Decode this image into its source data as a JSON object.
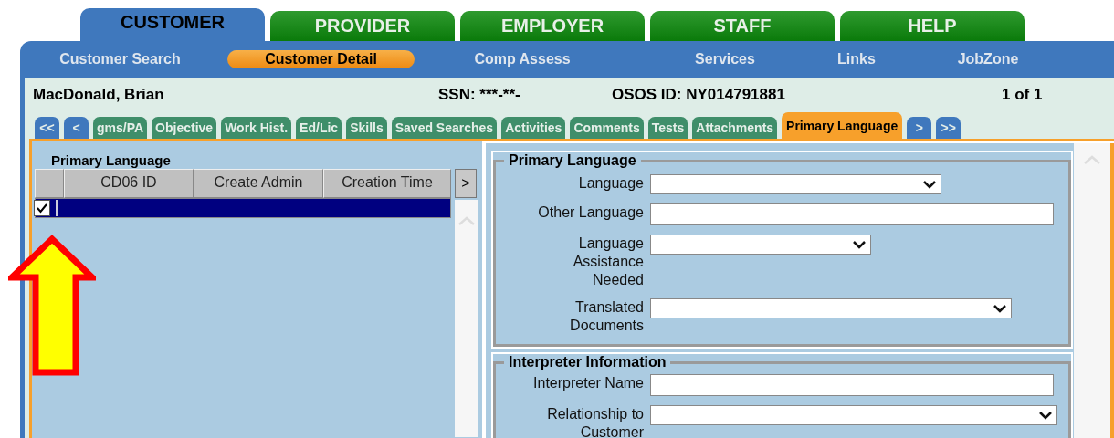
{
  "main_tabs": [
    {
      "label": "CUSTOMER",
      "selected": true
    },
    {
      "label": "PROVIDER",
      "selected": false
    },
    {
      "label": "EMPLOYER",
      "selected": false
    },
    {
      "label": "STAFF",
      "selected": false
    },
    {
      "label": "HELP",
      "selected": false
    }
  ],
  "sub_nav": [
    {
      "label": "Customer Search",
      "selected": false
    },
    {
      "label": "Customer Detail",
      "selected": true
    },
    {
      "label": "Comp Assess",
      "selected": false
    },
    {
      "label": "Services",
      "selected": false
    },
    {
      "label": "Links",
      "selected": false
    },
    {
      "label": "JobZone",
      "selected": false
    }
  ],
  "customer": {
    "name": "MacDonald, Brian",
    "ssn": "SSN: ***-**-",
    "osos_id": "OSOS ID: NY014791881",
    "record_count": "1 of 1"
  },
  "section_tabs": [
    {
      "label": "<<",
      "kind": "nav",
      "selected": false
    },
    {
      "label": "<",
      "kind": "nav",
      "selected": false
    },
    {
      "label": "gms/PA",
      "kind": "tab",
      "selected": false
    },
    {
      "label": "Objective",
      "kind": "tab",
      "selected": false
    },
    {
      "label": "Work Hist.",
      "kind": "tab",
      "selected": false
    },
    {
      "label": "Ed/Lic",
      "kind": "tab",
      "selected": false
    },
    {
      "label": "Skills",
      "kind": "tab",
      "selected": false
    },
    {
      "label": "Saved Searches",
      "kind": "tab",
      "selected": false
    },
    {
      "label": "Activities",
      "kind": "tab",
      "selected": false
    },
    {
      "label": "Comments",
      "kind": "tab",
      "selected": false
    },
    {
      "label": "Tests",
      "kind": "tab",
      "selected": false
    },
    {
      "label": "Attachments",
      "kind": "tab",
      "selected": false
    },
    {
      "label": "Primary Language",
      "kind": "tab",
      "selected": true
    },
    {
      "label": ">",
      "kind": "nav",
      "selected": false
    },
    {
      "label": ">>",
      "kind": "nav",
      "selected": false
    }
  ],
  "list_panel": {
    "title": "Primary Language",
    "columns": [
      "CD06 ID",
      "Create Admin",
      "Creation Time"
    ],
    "more_button": ">",
    "rows": [
      {
        "checked": true,
        "selected": true
      }
    ]
  },
  "fieldsets": [
    {
      "legend": "Primary Language",
      "fields": [
        {
          "label": "Language",
          "kind": "select"
        },
        {
          "label": "Other Language",
          "kind": "text"
        },
        {
          "label": "Language Assistance Needed",
          "kind": "select"
        },
        {
          "label": "Translated Documents",
          "kind": "select"
        }
      ]
    },
    {
      "legend": "Interpreter Information",
      "fields": [
        {
          "label": "Interpreter Name",
          "kind": "text"
        },
        {
          "label": "Relationship to Customer",
          "kind": "select"
        }
      ]
    }
  ]
}
